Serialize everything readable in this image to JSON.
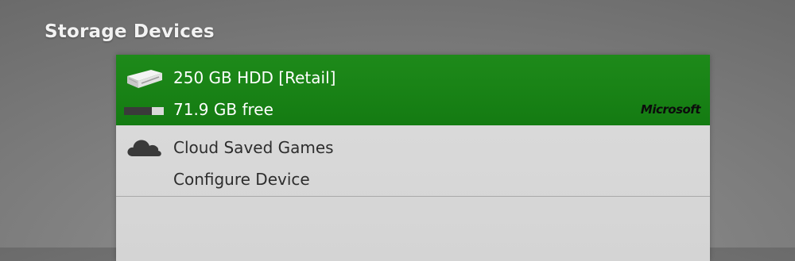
{
  "header": {
    "title": "Storage Devices"
  },
  "devices": [
    {
      "icon": "hard-drive-icon",
      "name": "250 GB HDD [Retail]",
      "free_space": "71.9 GB free",
      "used_fraction": 0.7,
      "brand": "Microsoft",
      "selected": true
    },
    {
      "icon": "cloud-icon",
      "name": "Cloud Saved Games",
      "action": "Configure Device",
      "selected": false
    }
  ],
  "colors": {
    "selection": "#168116",
    "panel": "#d8d8d8",
    "background": "#7e7e7e"
  }
}
